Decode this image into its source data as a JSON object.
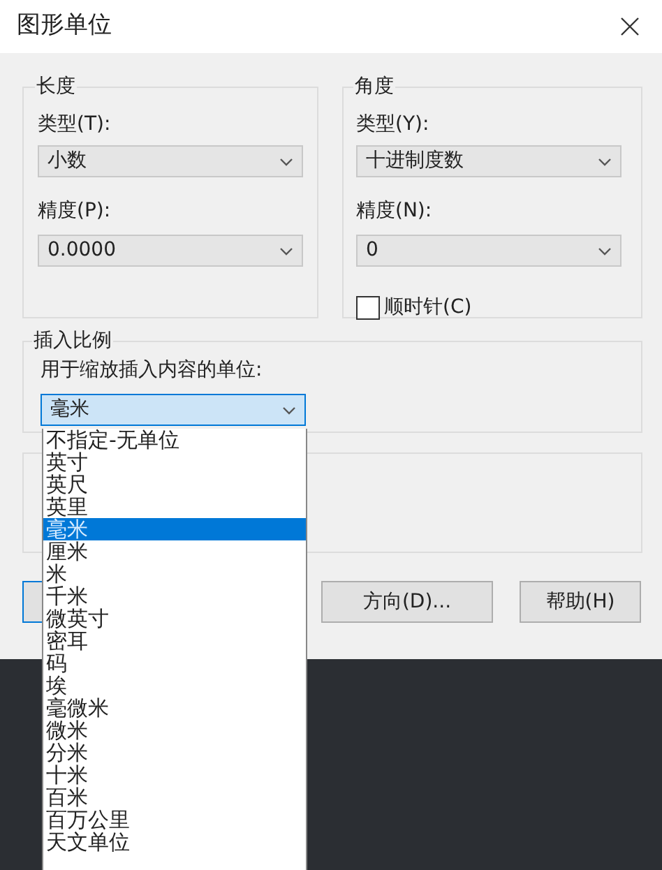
{
  "window": {
    "title": "图形单位"
  },
  "length": {
    "label": "长度",
    "type_label": "类型(T):",
    "type_value": "小数",
    "precision_label": "精度(P):",
    "precision_value": "0.0000"
  },
  "angle": {
    "label": "角度",
    "type_label": "类型(Y):",
    "type_value": "十进制度数",
    "precision_label": "精度(N):",
    "precision_value": "0",
    "clockwise": {
      "label": "顺时针(C)",
      "checked": false
    }
  },
  "insertion_scale": {
    "label": "插入比例",
    "units_label": "用于缩放插入内容的单位:",
    "units_value": "毫米",
    "expanded": true,
    "options": [
      {
        "label": "不指定-无单位",
        "selected": false
      },
      {
        "label": "英寸",
        "selected": false
      },
      {
        "label": "英尺",
        "selected": false
      },
      {
        "label": "英里",
        "selected": false
      },
      {
        "label": "毫米",
        "selected": true
      },
      {
        "label": "厘米",
        "selected": false
      },
      {
        "label": "米",
        "selected": false
      },
      {
        "label": "千米",
        "selected": false
      },
      {
        "label": "微英寸",
        "selected": false
      },
      {
        "label": "密耳",
        "selected": false
      },
      {
        "label": "码",
        "selected": false
      },
      {
        "label": "埃",
        "selected": false
      },
      {
        "label": "毫微米",
        "selected": false
      },
      {
        "label": "微米",
        "selected": false
      },
      {
        "label": "分米",
        "selected": false
      },
      {
        "label": "十米",
        "selected": false
      },
      {
        "label": "百米",
        "selected": false
      },
      {
        "label": "百万公里",
        "selected": false
      },
      {
        "label": "天文单位",
        "selected": false
      }
    ]
  },
  "buttons": [
    {
      "label": "方向(D)..."
    },
    {
      "label": "帮助(H)"
    }
  ]
}
